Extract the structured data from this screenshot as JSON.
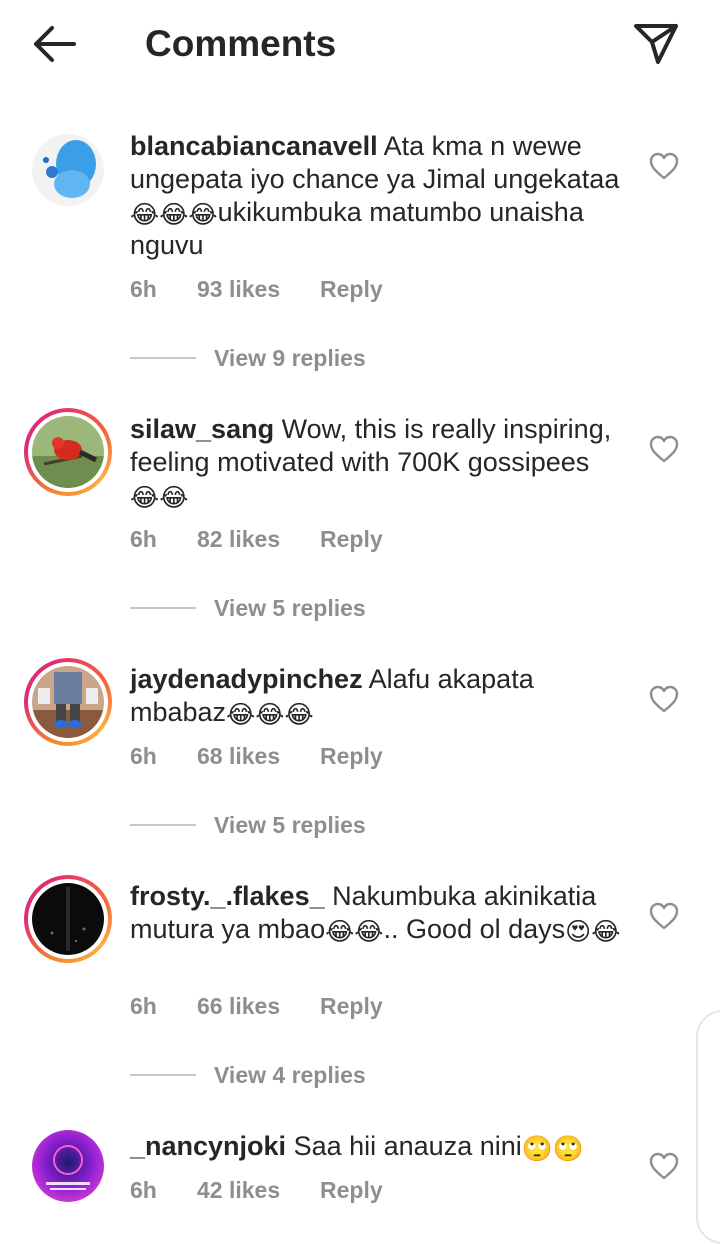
{
  "header": {
    "title": "Comments",
    "back_icon": "arrow-left-icon",
    "share_icon": "paper-plane-icon"
  },
  "comments": [
    {
      "username": "blancabiancanavell",
      "text_parts": [
        "Ata kma n wewe ungepata iyo chance ya Jimal ungekataa",
        "😂😂😂",
        "ukikumbuka matumbo unaisha nguvu"
      ],
      "time": "6h",
      "likes": "93 likes",
      "reply": "Reply",
      "view_replies": "View 9 replies"
    },
    {
      "username": "silaw_sang",
      "text_parts": [
        "Wow, this is really inspiring, feeling motivated with 700K gossipees",
        "😂😂"
      ],
      "time": "6h",
      "likes": "82 likes",
      "reply": "Reply",
      "view_replies": "View 5 replies"
    },
    {
      "username": "jaydenadypinchez",
      "text_parts": [
        "Alafu akapata mbabaz",
        "😂😂😂"
      ],
      "time": "6h",
      "likes": "68 likes",
      "reply": "Reply",
      "view_replies": "View 5 replies"
    },
    {
      "username": "frosty._.flakes_",
      "text_parts": [
        "Nakumbuka akinikatia mutura ya mbao",
        "😂😂",
        ".. Good ol days",
        "😍😂"
      ],
      "time": "6h",
      "likes": "66 likes",
      "reply": "Reply",
      "view_replies": "View 4 replies"
    },
    {
      "username": "_nancynjoki",
      "text_parts": [
        "Saa hii anauza nini",
        "🙄🙄"
      ],
      "time": "6h",
      "likes": "42 likes",
      "reply": "Reply"
    }
  ],
  "colors": {
    "text": "#262626",
    "muted": "#8e8e8e",
    "story_ring_start": "#f58529",
    "story_ring_end": "#dd2a7b"
  }
}
